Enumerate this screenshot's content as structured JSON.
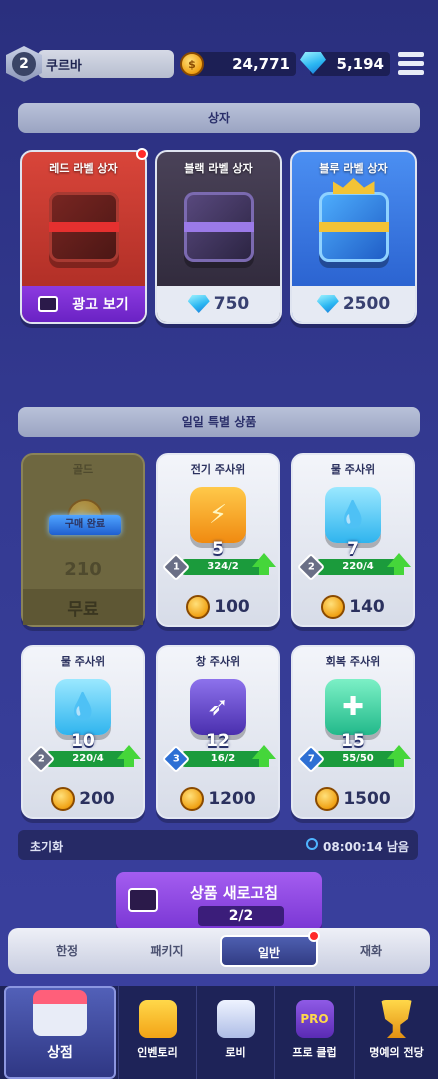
{
  "player": {
    "rank": "2",
    "name": "쿠르바"
  },
  "currency": {
    "gold": "24,771",
    "gems": "5,194"
  },
  "box_section": {
    "title": "상자"
  },
  "boxes": [
    {
      "title": "레드 라벨 상자",
      "price": "광고 보기",
      "has_badge": true,
      "color": "#c9382e"
    },
    {
      "title": "블랙 라벨 상자",
      "price": "750",
      "color": "#3b3448"
    },
    {
      "title": "블루 라벨 상자",
      "price": "2500",
      "color": "#2b6ee0"
    }
  ],
  "daily_section": {
    "title": "일일 특별 상품"
  },
  "daily_items": [
    {
      "name": "골드",
      "quantity": "210",
      "price": "무료",
      "purchased_label": "구매 완료",
      "purchased": true
    },
    {
      "name": "전기 주사위",
      "quantity": "5",
      "level": "1",
      "progress": "324/2",
      "price": "100",
      "icon": "lightning-icon",
      "color": "#f6a21a"
    },
    {
      "name": "물 주사위",
      "quantity": "7",
      "level": "2",
      "progress": "220/4",
      "price": "140",
      "icon": "water-drop-icon",
      "color": "#46c8f2"
    },
    {
      "name": "물 주사위",
      "quantity": "10",
      "level": "2",
      "progress": "220/4",
      "price": "200",
      "icon": "water-drop-icon",
      "color": "#46c8f2"
    },
    {
      "name": "창 주사위",
      "quantity": "12",
      "level": "3",
      "progress": "16/2",
      "price": "1200",
      "icon": "spear-icon",
      "color": "#6c4fd0"
    },
    {
      "name": "회복 주사위",
      "quantity": "15",
      "level": "7",
      "progress": "55/50",
      "price": "1500",
      "icon": "heal-icon",
      "color": "#3ed3a1"
    }
  ],
  "reset": {
    "label": "초기화",
    "time": "08:00:14 남음"
  },
  "refresh": {
    "label": "상품 새로고침",
    "count": "2/2"
  },
  "tabs": [
    {
      "label": "한정"
    },
    {
      "label": "패키지"
    },
    {
      "label": "일반",
      "active": true
    },
    {
      "label": "재화"
    }
  ],
  "nav": [
    {
      "label": "상점",
      "active": true
    },
    {
      "label": "인벤토리"
    },
    {
      "label": "로비"
    },
    {
      "label": "프로 클럽"
    },
    {
      "label": "명예의 전당"
    }
  ]
}
